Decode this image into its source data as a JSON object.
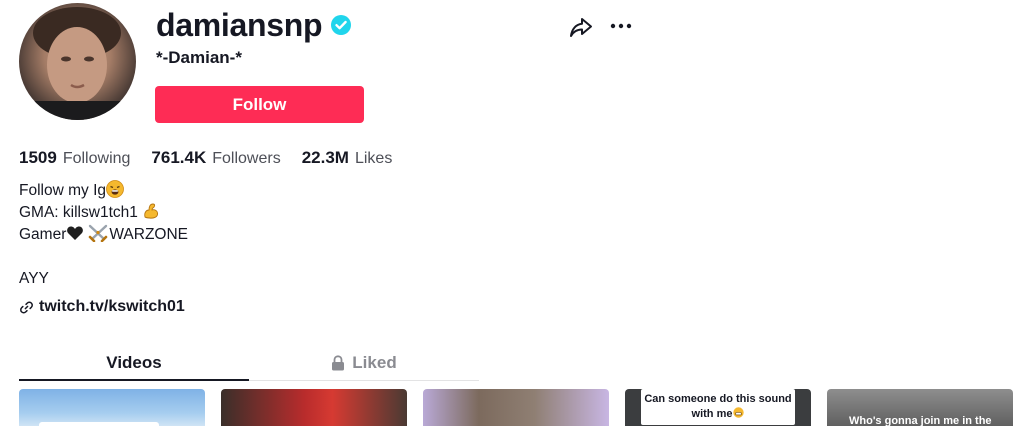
{
  "profile": {
    "username": "damiansnp",
    "nickname": "*-Damian-*",
    "follow_label": "Follow",
    "verified": true
  },
  "stats": [
    {
      "value": "1509",
      "label": "Following"
    },
    {
      "value": "761.4K",
      "label": "Followers"
    },
    {
      "value": "22.3M",
      "label": "Likes"
    }
  ],
  "bio": {
    "line1": "Follow my Ig",
    "line2": "GMA: killsw1tch1",
    "line3_a": "Gamer",
    "line3_b": "WARZONE",
    "line4": "AYY"
  },
  "link": {
    "text": "twitch.tv/kswitch01",
    "icon": "link-icon"
  },
  "tabs": {
    "videos": "Videos",
    "liked": "Liked"
  },
  "thumbnails": [
    {
      "caption": ""
    },
    {
      "caption": ""
    },
    {
      "caption": ""
    },
    {
      "caption_line1": "Can someone do this sound",
      "caption_line2": "with me"
    },
    {
      "caption": "Who's gonna join me in the"
    }
  ],
  "icons": {
    "share": "share-icon",
    "more": "more-icon",
    "verified": "verified-badge-icon",
    "lock": "lock-icon"
  },
  "colors": {
    "accent": "#fe2c55",
    "verified": "#20d5ec",
    "text": "#161823",
    "muted": "#8a8b91"
  }
}
